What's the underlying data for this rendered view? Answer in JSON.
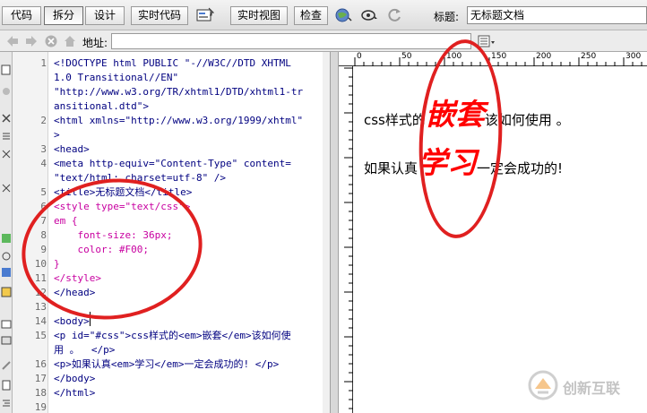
{
  "toolbar": {
    "code_label": "代码",
    "split_label": "拆分",
    "design_label": "设计",
    "live_code_label": "实时代码",
    "live_view_label": "实时视图",
    "inspect_label": "检查",
    "title_label": "标题:",
    "title_value": "无标题文档"
  },
  "addressbar": {
    "label": "地址:",
    "value": ""
  },
  "code": {
    "line_numbers": [
      "1",
      "2",
      "3",
      "4",
      "5",
      "6",
      "7",
      "8",
      "9",
      "10",
      "11",
      "12",
      "13",
      "14",
      "15",
      "16",
      "17",
      "18",
      "19"
    ],
    "lines": [
      "<!DOCTYPE html PUBLIC \"-//W3C//DTD XHTML",
      "1.0 Transitional//EN\"",
      "\"http://www.w3.org/TR/xhtml1/DTD/xhtml1-tr",
      "ansitional.dtd\">",
      "<html xmlns=\"http://www.w3.org/1999/xhtml\"",
      ">",
      "<head>",
      "<meta http-equiv=\"Content-Type\" content=",
      "\"text/html; charset=utf-8\" />",
      "<title>无标题文档</title>",
      "<style type=\"text/css\">",
      "em {",
      "    font-size: 36px;",
      "    color: #F00;",
      "}",
      "</style>",
      "</head>",
      "",
      "<body>",
      "<p id=\"#css\">css样式的<em>嵌套</em>该如何使",
      "用 。  </p>",
      "<p>如果认真<em>学习</em>一定会成功的! </p>",
      "</body>",
      "</html>"
    ]
  },
  "design": {
    "ruler_labels": [
      "0",
      "50",
      "100",
      "150",
      "200",
      "250",
      "300"
    ],
    "p1_before": "css样式的",
    "p1_em": "嵌套",
    "p1_after": "该如何使用 。",
    "p2_before": "如果认真",
    "p2_em": "学习",
    "p2_after": "一定会成功的!"
  },
  "watermark": {
    "text": "创新互联"
  },
  "colors": {
    "annotation_red": "#e02020",
    "em_red": "#ff0000",
    "tag_navy": "#000080",
    "css_pink": "#c800a0"
  }
}
